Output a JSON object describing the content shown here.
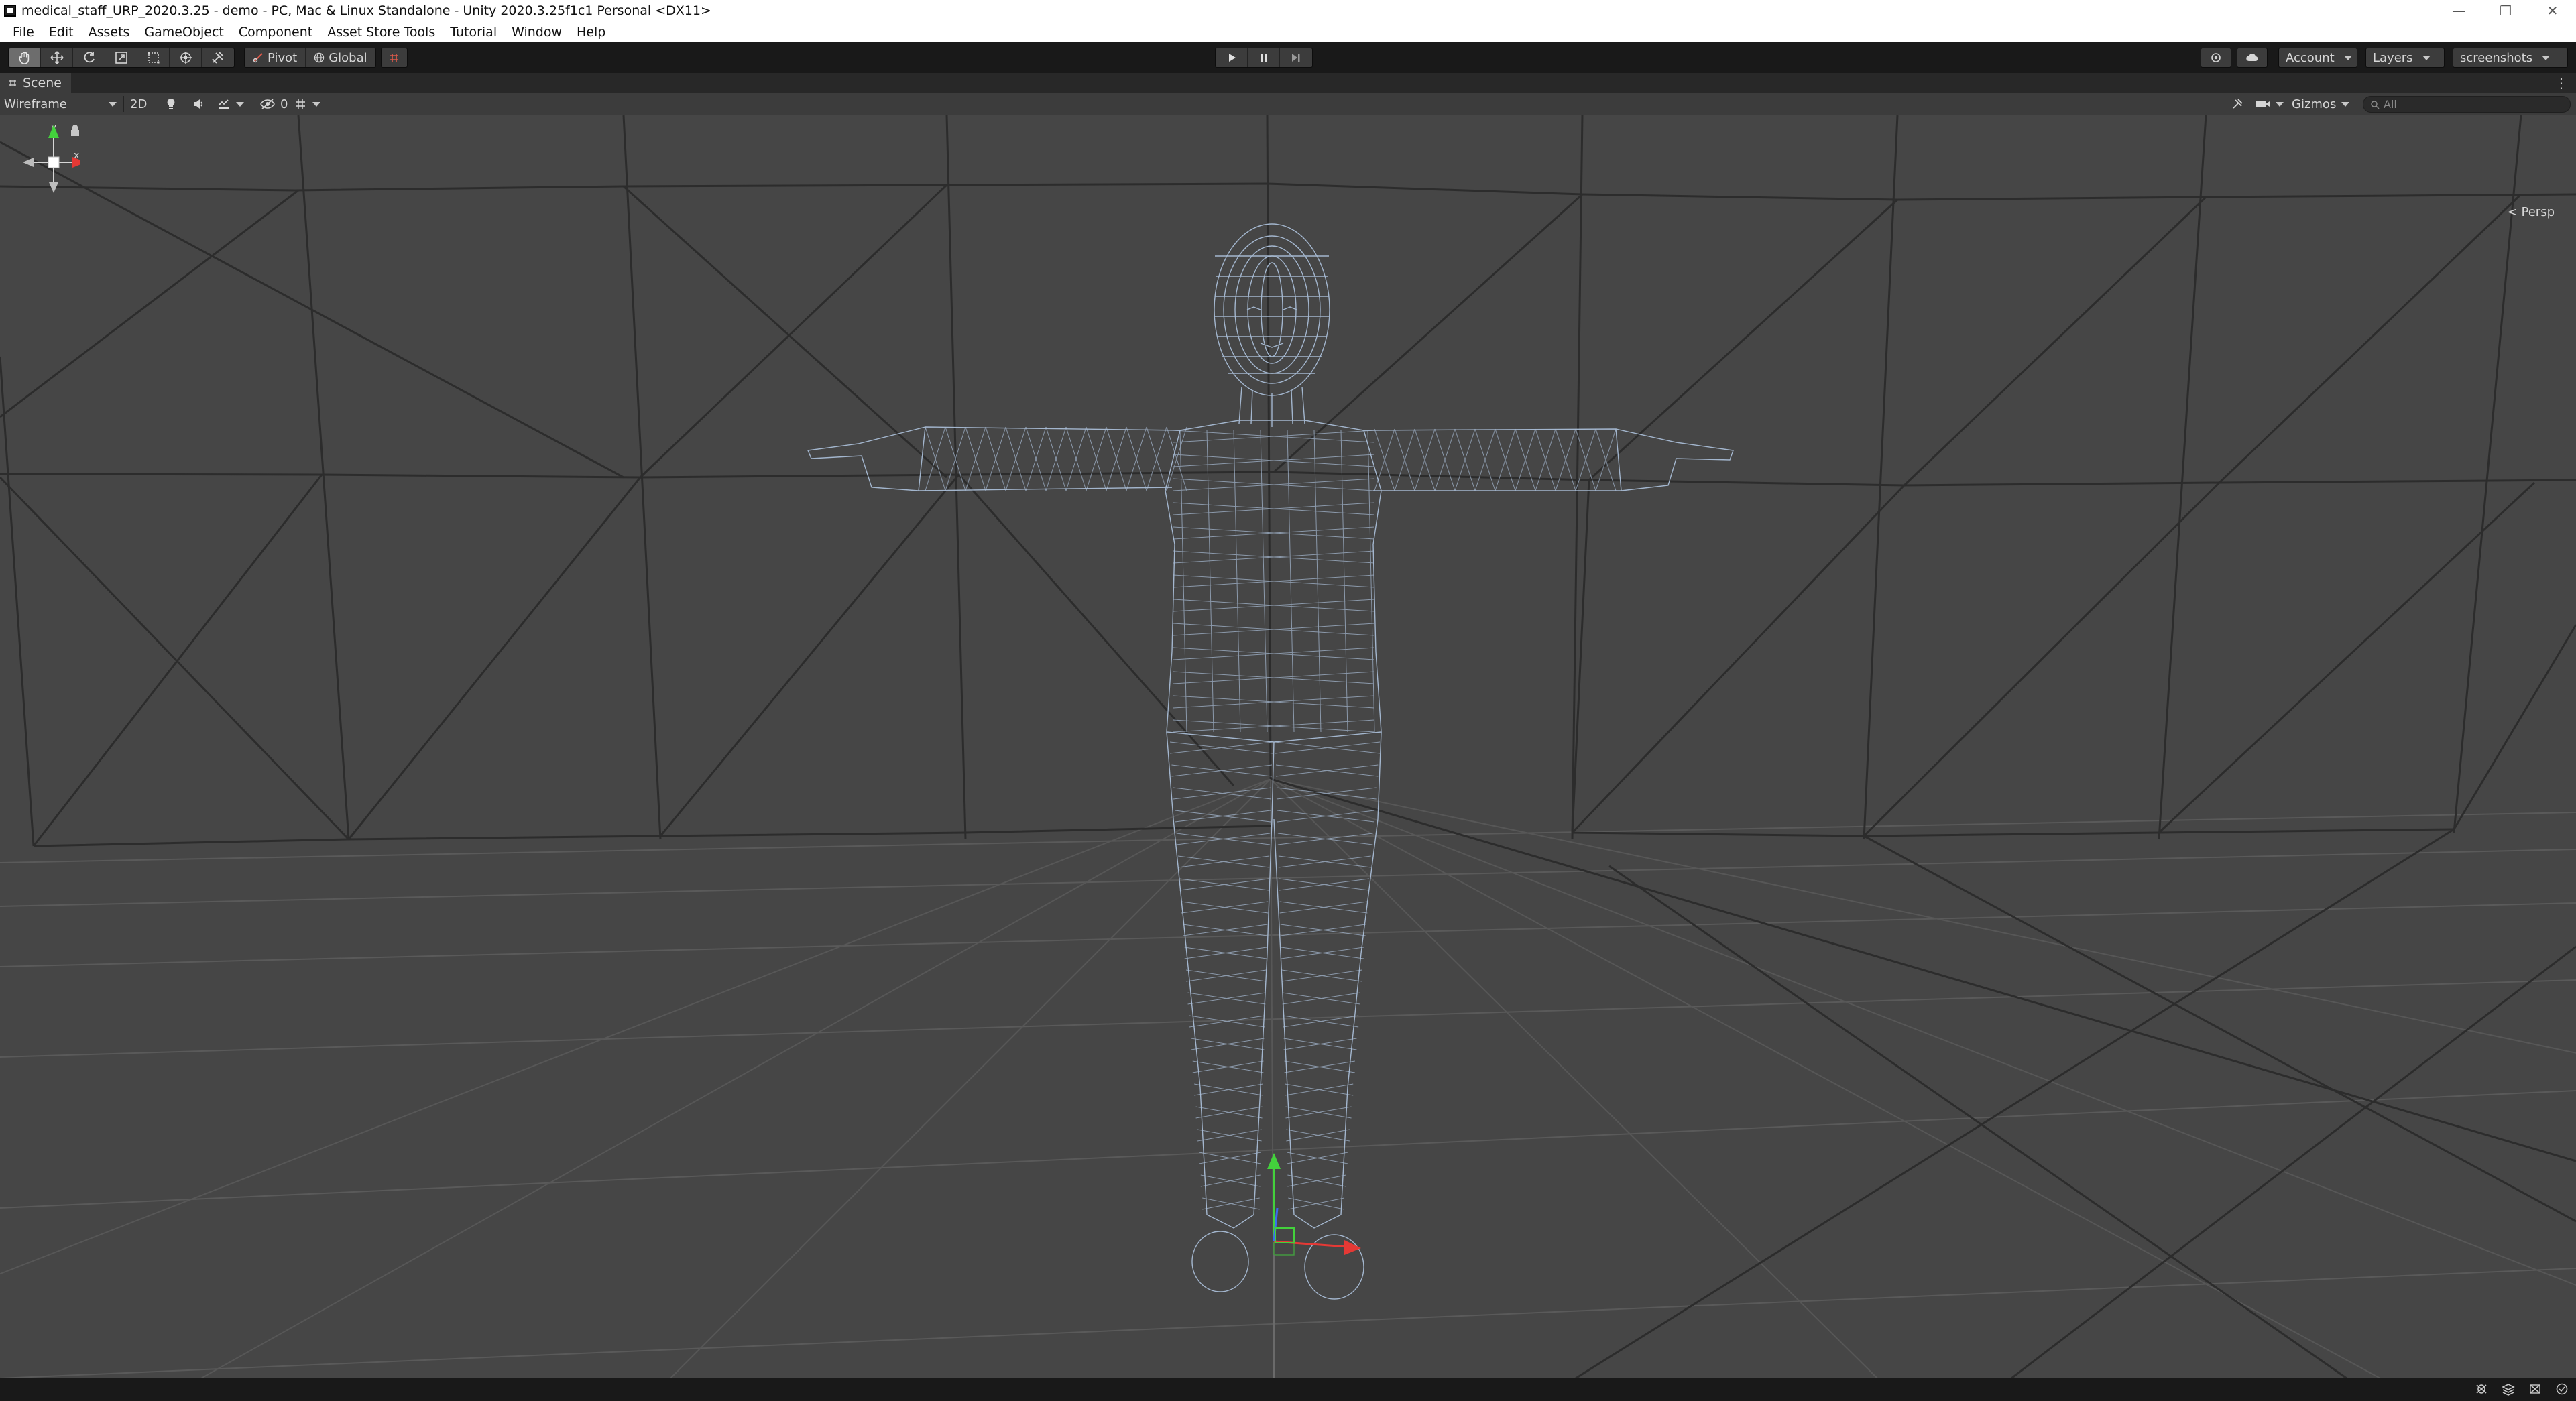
{
  "window": {
    "title": "medical_staff_URP_2020.3.25 - demo - PC, Mac & Linux Standalone - Unity 2020.3.25f1c1 Personal <DX11>",
    "controls": [
      "minimize",
      "restore",
      "close"
    ]
  },
  "menu": {
    "items": [
      "File",
      "Edit",
      "Assets",
      "GameObject",
      "Component",
      "Asset Store Tools",
      "Tutorial",
      "Window",
      "Help"
    ]
  },
  "toolbar": {
    "tools": [
      "hand-tool",
      "move-tool",
      "rotate-tool",
      "scale-tool",
      "rect-tool",
      "transform-tool",
      "custom-tool"
    ],
    "pivot_label": "Pivot",
    "global_label": "Global",
    "account_label": "Account",
    "layers_label": "Layers",
    "layout_label": "screenshots"
  },
  "scene_tab": {
    "label": "Scene"
  },
  "scene_toolbar": {
    "draw_mode": "Wireframe",
    "mode_2d": "2D",
    "hidden_count": "0",
    "gizmos_label": "Gizmos",
    "search_placeholder": "All"
  },
  "viewport": {
    "projection_label": "< Persp",
    "axis_labels": {
      "y": "y",
      "x": "x"
    },
    "colors": {
      "background": "#464646",
      "grid": "#5c5c5c",
      "wall_lines": "#2a2a2a",
      "wireframe": "#a9bdd6",
      "axis_x": "#e53935",
      "axis_y": "#43d13c",
      "axis_z": "#3a6cf0"
    }
  },
  "icons": {
    "app": "unity-logo-icon",
    "play": "play-icon",
    "pause": "pause-icon",
    "step": "step-icon",
    "services": "cloud-icon",
    "collab": "collab-icon"
  }
}
